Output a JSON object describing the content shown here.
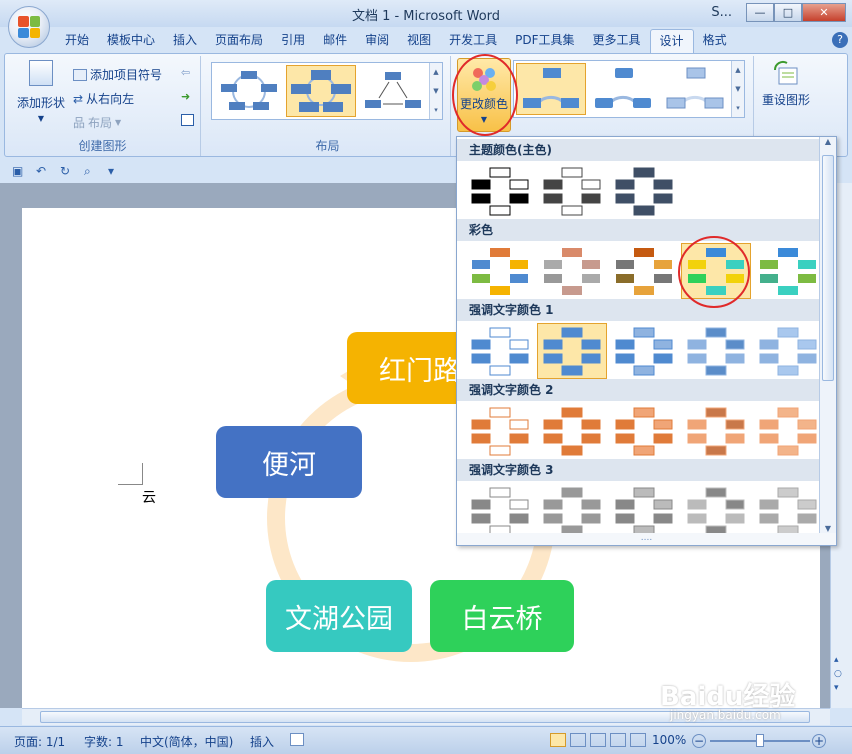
{
  "window": {
    "title": "文档 1 - Microsoft Word",
    "s_label": "S...",
    "controls": {
      "minimize": "—",
      "maximize": "□",
      "close": "✕"
    }
  },
  "tabs": [
    "开始",
    "模板中心",
    "插入",
    "页面布局",
    "引用",
    "邮件",
    "审阅",
    "视图",
    "开发工具",
    "PDF工具集",
    "更多工具",
    "设计",
    "格式"
  ],
  "active_tab": "设计",
  "ribbon": {
    "create_group": {
      "label": "创建图形",
      "add_shape": "添加形状",
      "add_bullet": "添加项目符号",
      "rtl": "从右向左",
      "layout": "布局"
    },
    "layout_group": {
      "label": "布局"
    },
    "change_colors": "更改颜色",
    "reset_graphic": "重设图形"
  },
  "dropdown": {
    "sections": [
      {
        "title": "主题颜色(主色)"
      },
      {
        "title": "彩色"
      },
      {
        "title": "强调文字颜色 1"
      },
      {
        "title": "强调文字颜色 2"
      },
      {
        "title": "强调文字颜色 3"
      }
    ],
    "grip": "....",
    "selected_variant": "彩色 - 强调文字颜色 4 至 5"
  },
  "document": {
    "cursor_text": "云",
    "nodes": {
      "top": "红门路",
      "left": "便河",
      "bottom_left": "文湖公园",
      "bottom_right": "白云桥"
    },
    "node_colors": {
      "top": "#f5b301",
      "left": "#4472c4",
      "bottom_left": "#36c9c0",
      "bottom_right": "#2ed15a"
    },
    "arrow_color": "#fde7c8"
  },
  "statusbar": {
    "page": "页面: 1/1",
    "words": "字数: 1",
    "language": "中文(简体，中国)",
    "mode": "插入",
    "zoom": "100%"
  },
  "watermark": {
    "main": "Baidu经验",
    "sub": "jingyan.baidu.com"
  }
}
